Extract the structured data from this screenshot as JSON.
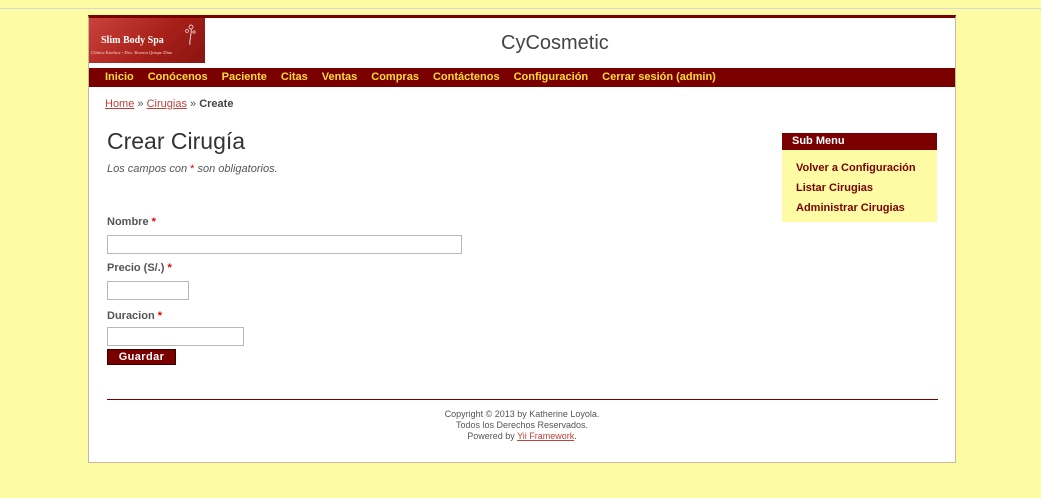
{
  "logo": {
    "title": "Slim Body Spa",
    "subtitle": "Clínica Estética - Dra. Yesenia Quispe Díaz"
  },
  "site_title": "CyCosmetic",
  "mainmenu": [
    "Inicio",
    "Conócenos",
    "Paciente",
    "Citas",
    "Ventas",
    "Compras",
    "Contáctenos",
    "Configuración",
    "Cerrar sesión (admin)"
  ],
  "breadcrumb": {
    "home": "Home",
    "sep": "»",
    "section": "Cirugias",
    "current": "Create"
  },
  "form": {
    "heading": "Crear Cirugía",
    "note_before": "Los campos con",
    "note_star": "*",
    "note_after": "son obligatorios.",
    "fields": [
      {
        "label": "Nombre",
        "value": ""
      },
      {
        "label": "Precio (S/.)",
        "value": ""
      },
      {
        "label": "Duracion",
        "value": ""
      }
    ],
    "required_mark": "*",
    "submit_label": "Guardar"
  },
  "submenu": {
    "title": "Sub Menu",
    "items": [
      "Volver a Configuración",
      "Listar Cirugias",
      "Administrar Cirugias"
    ]
  },
  "footer": {
    "copyright": "Copyright © 2013 by Katherine Loyola.",
    "rights": "Todos los Derechos Reservados.",
    "powered_prefix": "Powered by",
    "powered_link": "Yii Framework",
    "powered_suffix": "."
  },
  "colors": {
    "background": "#fdfba4",
    "brand": "#7a0000",
    "menu_text": "#fddc3a",
    "link": "#c0413a"
  },
  "icons": {
    "logo_decoration": "flower-icon"
  }
}
